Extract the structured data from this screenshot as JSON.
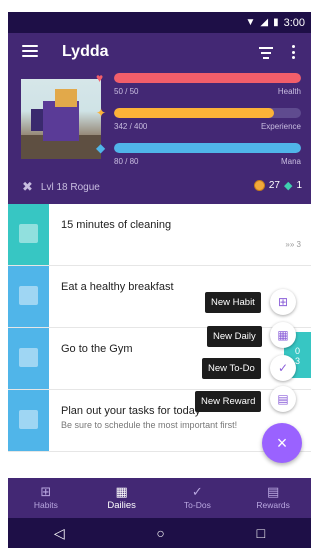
{
  "status_bar": {
    "time": "3:00"
  },
  "header": {
    "username": "Lydda",
    "stats": [
      {
        "value": "50 / 50",
        "label": "Health",
        "fraction": 1.0,
        "color": "#f25e6a"
      },
      {
        "value": "342 / 400",
        "label": "Experience",
        "fraction": 0.855,
        "color": "#fcb338"
      },
      {
        "value": "80 / 80",
        "label": "Mana",
        "fraction": 1.0,
        "color": "#50b5e9"
      }
    ],
    "level": "Lvl 18 Rogue",
    "gold": "27",
    "gems": "1"
  },
  "tasks": [
    {
      "title": "15 minutes of cleaning",
      "notes": "",
      "streak": "3",
      "color": "#37c6c3"
    },
    {
      "title": "Eat a healthy breakfast",
      "notes": "",
      "streak": "",
      "color": "#50b5e9"
    },
    {
      "title": "Go to the Gym",
      "notes": "",
      "streak": "",
      "color": "#50b5e9"
    },
    {
      "title": "Plan out your tasks for today",
      "notes": "Be sure to schedule the most important first!",
      "streak": "",
      "color": "#50b5e9"
    }
  ],
  "side_tab": {
    "line1": "0",
    "line2": "3"
  },
  "fab_menu": {
    "new_habit": "New Habit",
    "new_daily": "New Daily",
    "new_todo": "New To-Do",
    "new_reward": "New Reward",
    "close_symbol": "×"
  },
  "bottom_nav": {
    "habits": "Habits",
    "dailies": "Dailies",
    "todos": "To-Dos",
    "rewards": "Rewards"
  },
  "colors": {
    "header_bg": "#432874",
    "status_bg": "#1e0f47",
    "accent": "#9a62ff"
  }
}
